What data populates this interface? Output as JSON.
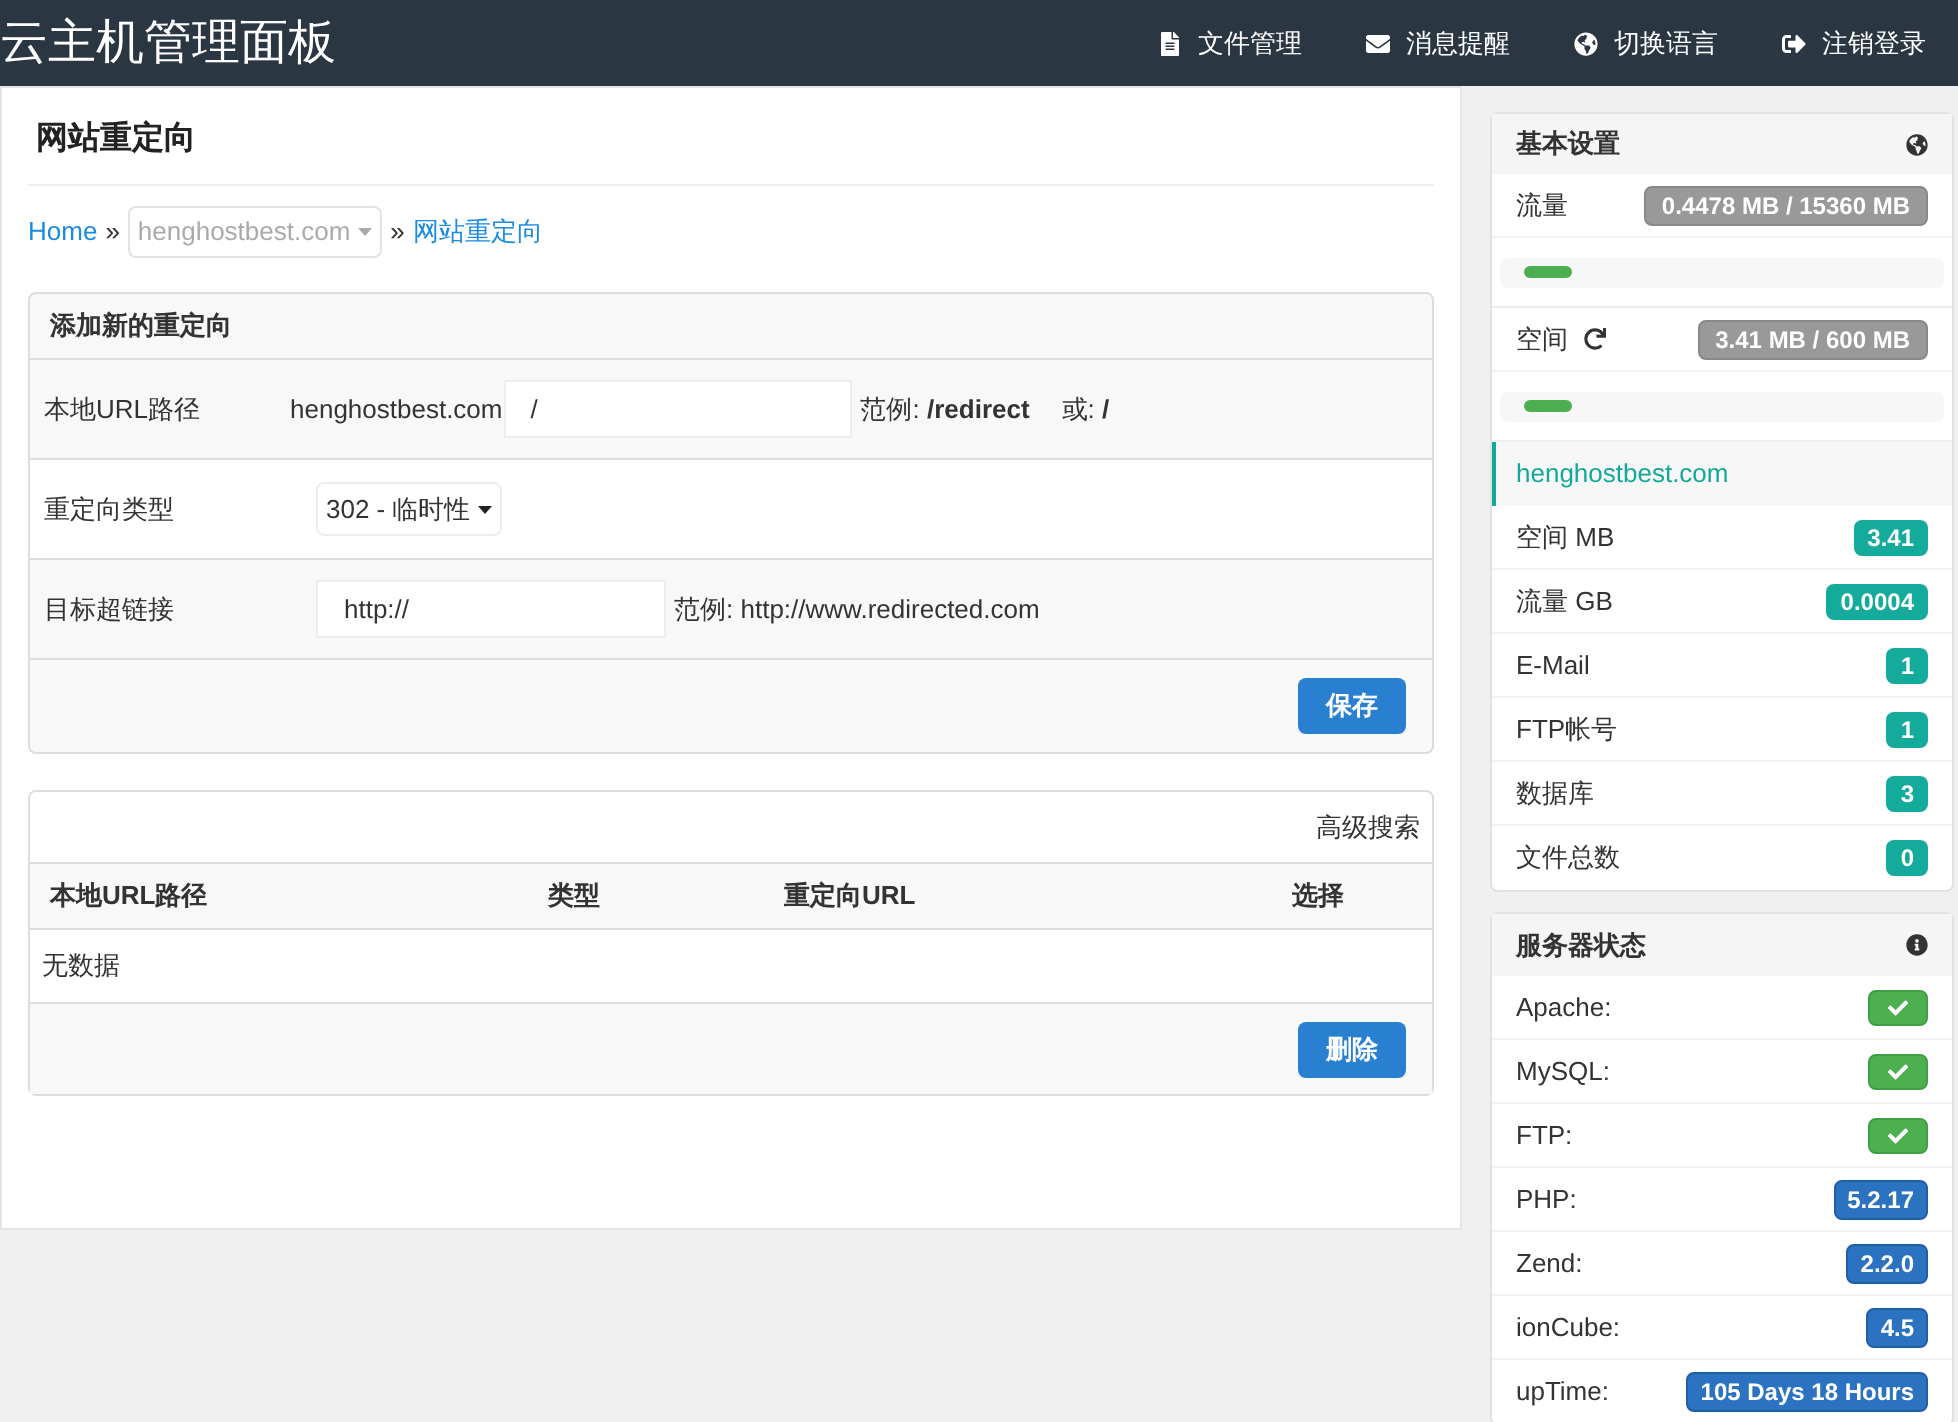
{
  "header": {
    "title": "云主机管理面板",
    "nav": [
      "文件管理",
      "消息提醒",
      "切换语言",
      "注销登录"
    ]
  },
  "page": {
    "title": "网站重定向",
    "breadcrumb": {
      "home": "Home",
      "sep": "»",
      "domain": "henghostbest.com",
      "sep2": "»",
      "current": "网站重定向"
    },
    "form": {
      "title": "添加新的重定向",
      "rows": [
        {
          "kind": "path",
          "label": "本地URL路径",
          "prefix": "henghostbest.com",
          "value": "/",
          "hint": "范例:",
          "example": "/redirect",
          "or": "或:",
          "example2": "/"
        },
        {
          "kind": "select",
          "label": "重定向类型",
          "value": "302 - 临时性"
        },
        {
          "kind": "url",
          "label": "目标超链接",
          "value": "http://",
          "hint": "范例:",
          "example": "http://www.redirected.com"
        }
      ],
      "save": "保存"
    },
    "table": {
      "search": "高级搜索",
      "columns": [
        "本地URL路径",
        "类型",
        "重定向URL",
        "选择"
      ],
      "empty": "无数据",
      "delete": "删除"
    }
  },
  "basic": {
    "title": "基本设置",
    "usage": [
      {
        "label": "流量",
        "refresh": false,
        "reading": "0.4478 MB / 15360 MB",
        "level": 0.12
      },
      {
        "label": "空间",
        "refresh": true,
        "reading": "3.41 MB / 600 MB",
        "level": 0.12
      }
    ],
    "domain": "henghostbest.com",
    "stats": [
      {
        "label": "空间 MB",
        "value": "3.41"
      },
      {
        "label": "流量 GB",
        "value": "0.0004"
      },
      {
        "label": "E-Mail",
        "value": "1"
      },
      {
        "label": "FTP帐号",
        "value": "1"
      },
      {
        "label": "数据库",
        "value": "3"
      },
      {
        "label": "文件总数",
        "value": "0"
      }
    ]
  },
  "server": {
    "title": "服务器状态",
    "items": [
      {
        "label": "Apache:",
        "kind": "check"
      },
      {
        "label": "MySQL:",
        "kind": "check"
      },
      {
        "label": "FTP:",
        "kind": "check"
      },
      {
        "label": "PHP:",
        "kind": "version",
        "value": "5.2.17"
      },
      {
        "label": "Zend:",
        "kind": "version",
        "value": "2.2.0"
      },
      {
        "label": "ionCube:",
        "kind": "version",
        "value": "4.5"
      },
      {
        "label": "upTime:",
        "kind": "version",
        "value": "105 Days 18 Hours"
      }
    ]
  }
}
